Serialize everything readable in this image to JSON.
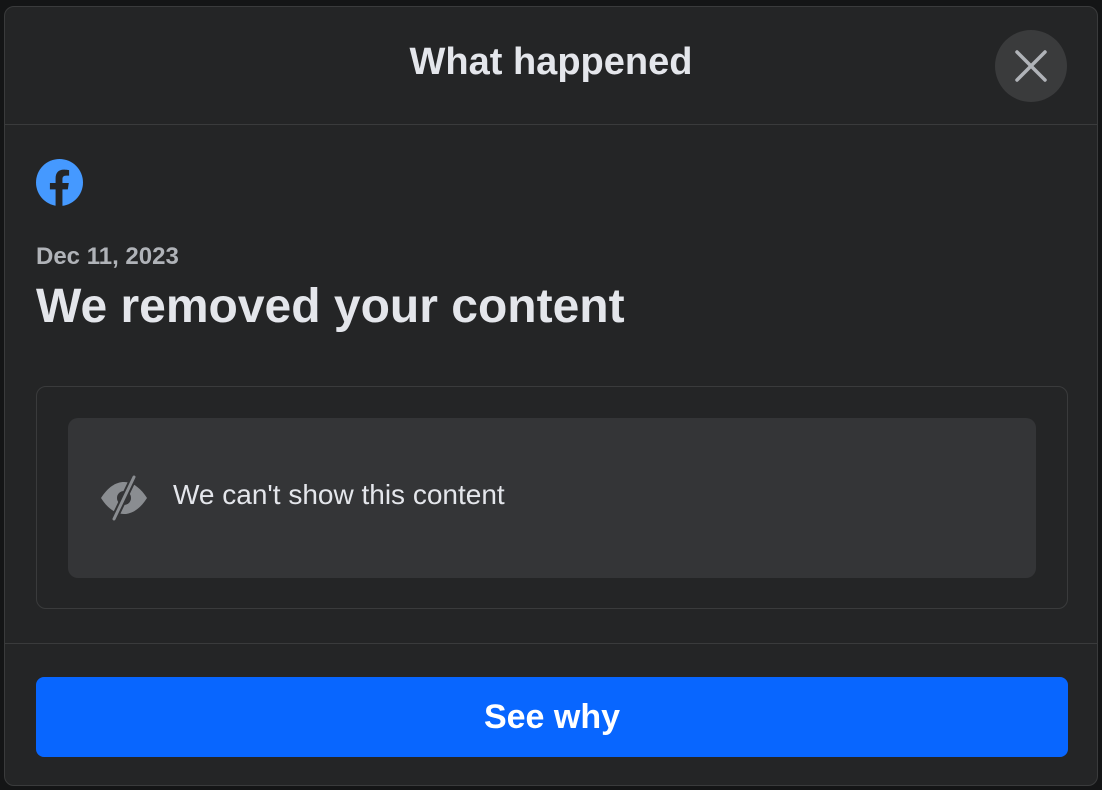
{
  "dialog": {
    "title": "What happened",
    "close_icon": "close-icon",
    "brand_icon": "facebook-icon",
    "date": "Dec 11, 2023",
    "headline": "We removed your content",
    "hidden_notice": {
      "icon": "eye-slash-icon",
      "text": "We can't show this content"
    },
    "primary_button": "See why"
  },
  "colors": {
    "dialog_bg": "#242526",
    "content_box_bg": "#343537",
    "primary_blue": "#0866ff",
    "facebook_blue": "#4599ff",
    "text_primary": "#e4e6eb",
    "text_secondary": "#b0b3b8"
  }
}
